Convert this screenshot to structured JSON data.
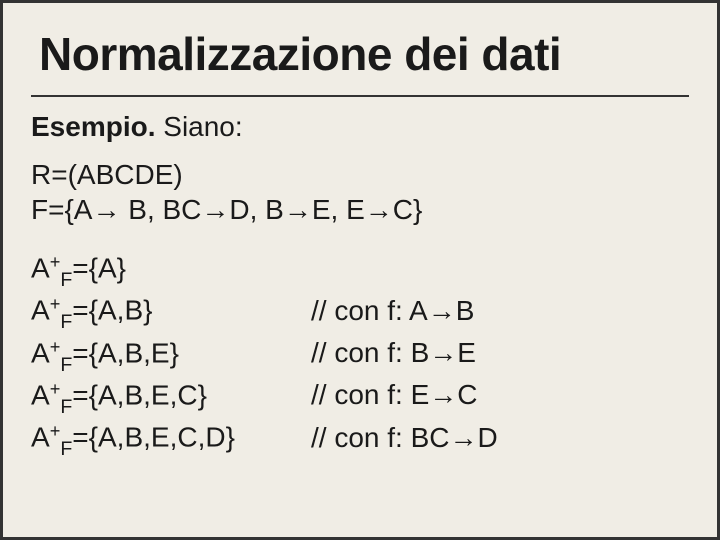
{
  "title": "Normalizzazione dei dati",
  "example_label_bold": "Esempio.",
  "example_label_rest": " Siano:",
  "defs": {
    "line1": "R=(ABCDE)",
    "line2_pre": "F={A",
    "line2_a1": "→",
    "line2_m1": " B, BC",
    "line2_a2": "→",
    "line2_m2": "D, B",
    "line2_a3": "→",
    "line2_m3": "E, E",
    "line2_a4": "→",
    "line2_end": "C}"
  },
  "closures": [
    {
      "sym": "A",
      "sup": "+",
      "sub": "F",
      "set": "={A}",
      "note": ""
    },
    {
      "sym": "A",
      "sup": "+",
      "sub": "F",
      "set": "={A,B}",
      "note": "// con f: A→B"
    },
    {
      "sym": "A",
      "sup": "+",
      "sub": "F",
      "set": "={A,B,E}",
      "note": "// con f: B→E"
    },
    {
      "sym": "A",
      "sup": "+",
      "sub": "F",
      "set": "={A,B,E,C}",
      "note": "// con f: E→C"
    },
    {
      "sym": "A",
      "sup": "+",
      "sub": "F",
      "set": "={A,B,E,C,D}",
      "note": "// con f: BC→D"
    }
  ]
}
